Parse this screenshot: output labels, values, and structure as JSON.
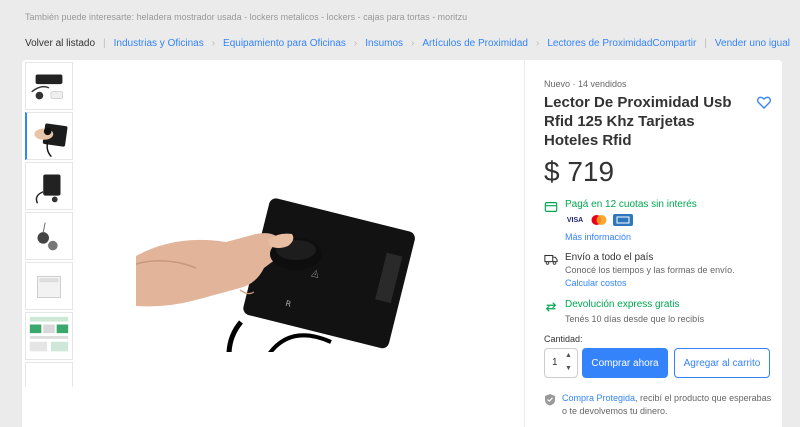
{
  "suggestions": "También puede interesarte: heladera mostrador usada - lockers metalicos - lockers - cajas para tortas - moritzu",
  "breadcrumb": {
    "back": "Volver al listado",
    "items": [
      "Industrias y Oficinas",
      "Equipamiento para Oficinas",
      "Insumos",
      "Artículos de Proximidad",
      "Lectores de Proximidad"
    ],
    "share": "Compartir",
    "sell": "Vender uno igual"
  },
  "product": {
    "condition": "Nuevo  ·  14 vendidos",
    "title": "Lector De Proximidad Usb Rfid 125 Khz Tarjetas Hoteles Rfid",
    "price": "$ 719"
  },
  "payment": {
    "cuotas": "Pagá en 12 cuotas sin interés",
    "card_visa": "VISA",
    "more": "Más información"
  },
  "shipping": {
    "title": "Envío a todo el país",
    "sub": "Conocé los tiempos y las formas de envío.",
    "link": "Calcular costos"
  },
  "returns": {
    "title": "Devolución express gratis",
    "sub": "Tenés 10 días desde que lo recibís"
  },
  "purchase": {
    "qty_label": "Cantidad:",
    "qty_value": "1",
    "buy_label": "Comprar ahora",
    "cart_label": "Agregar al carrito"
  },
  "protection": {
    "link": "Compra Protegida",
    "text": ", recibí el producto que esperabas o te devolvemos tu dinero."
  },
  "colors": {
    "accent": "#3483fa",
    "green": "#00a650",
    "background": "#ebebeb"
  },
  "icons": [
    "heart-icon",
    "credit-card-icon",
    "truck-icon",
    "return-icon",
    "shield-icon",
    "chevron-up-icon",
    "chevron-down-icon"
  ]
}
